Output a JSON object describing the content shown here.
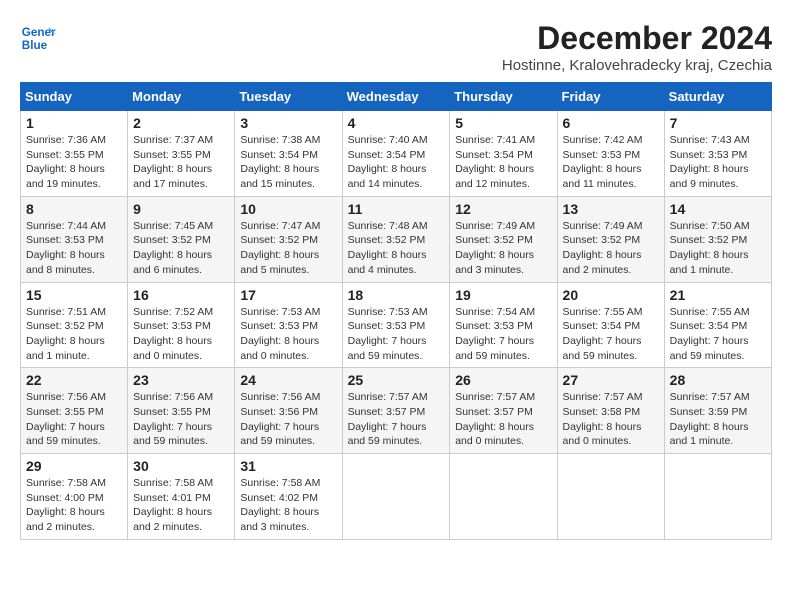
{
  "logo": {
    "line1": "General",
    "line2": "Blue"
  },
  "title": "December 2024",
  "subtitle": "Hostinne, Kralovehradecky kraj, Czechia",
  "headers": [
    "Sunday",
    "Monday",
    "Tuesday",
    "Wednesday",
    "Thursday",
    "Friday",
    "Saturday"
  ],
  "weeks": [
    [
      {
        "day": "1",
        "sunrise": "7:36 AM",
        "sunset": "3:55 PM",
        "daylight": "8 hours and 19 minutes."
      },
      {
        "day": "2",
        "sunrise": "7:37 AM",
        "sunset": "3:55 PM",
        "daylight": "8 hours and 17 minutes."
      },
      {
        "day": "3",
        "sunrise": "7:38 AM",
        "sunset": "3:54 PM",
        "daylight": "8 hours and 15 minutes."
      },
      {
        "day": "4",
        "sunrise": "7:40 AM",
        "sunset": "3:54 PM",
        "daylight": "8 hours and 14 minutes."
      },
      {
        "day": "5",
        "sunrise": "7:41 AM",
        "sunset": "3:54 PM",
        "daylight": "8 hours and 12 minutes."
      },
      {
        "day": "6",
        "sunrise": "7:42 AM",
        "sunset": "3:53 PM",
        "daylight": "8 hours and 11 minutes."
      },
      {
        "day": "7",
        "sunrise": "7:43 AM",
        "sunset": "3:53 PM",
        "daylight": "8 hours and 9 minutes."
      }
    ],
    [
      {
        "day": "8",
        "sunrise": "7:44 AM",
        "sunset": "3:53 PM",
        "daylight": "8 hours and 8 minutes."
      },
      {
        "day": "9",
        "sunrise": "7:45 AM",
        "sunset": "3:52 PM",
        "daylight": "8 hours and 6 minutes."
      },
      {
        "day": "10",
        "sunrise": "7:47 AM",
        "sunset": "3:52 PM",
        "daylight": "8 hours and 5 minutes."
      },
      {
        "day": "11",
        "sunrise": "7:48 AM",
        "sunset": "3:52 PM",
        "daylight": "8 hours and 4 minutes."
      },
      {
        "day": "12",
        "sunrise": "7:49 AM",
        "sunset": "3:52 PM",
        "daylight": "8 hours and 3 minutes."
      },
      {
        "day": "13",
        "sunrise": "7:49 AM",
        "sunset": "3:52 PM",
        "daylight": "8 hours and 2 minutes."
      },
      {
        "day": "14",
        "sunrise": "7:50 AM",
        "sunset": "3:52 PM",
        "daylight": "8 hours and 1 minute."
      }
    ],
    [
      {
        "day": "15",
        "sunrise": "7:51 AM",
        "sunset": "3:52 PM",
        "daylight": "8 hours and 1 minute."
      },
      {
        "day": "16",
        "sunrise": "7:52 AM",
        "sunset": "3:53 PM",
        "daylight": "8 hours and 0 minutes."
      },
      {
        "day": "17",
        "sunrise": "7:53 AM",
        "sunset": "3:53 PM",
        "daylight": "8 hours and 0 minutes."
      },
      {
        "day": "18",
        "sunrise": "7:53 AM",
        "sunset": "3:53 PM",
        "daylight": "7 hours and 59 minutes."
      },
      {
        "day": "19",
        "sunrise": "7:54 AM",
        "sunset": "3:53 PM",
        "daylight": "7 hours and 59 minutes."
      },
      {
        "day": "20",
        "sunrise": "7:55 AM",
        "sunset": "3:54 PM",
        "daylight": "7 hours and 59 minutes."
      },
      {
        "day": "21",
        "sunrise": "7:55 AM",
        "sunset": "3:54 PM",
        "daylight": "7 hours and 59 minutes."
      }
    ],
    [
      {
        "day": "22",
        "sunrise": "7:56 AM",
        "sunset": "3:55 PM",
        "daylight": "7 hours and 59 minutes."
      },
      {
        "day": "23",
        "sunrise": "7:56 AM",
        "sunset": "3:55 PM",
        "daylight": "7 hours and 59 minutes."
      },
      {
        "day": "24",
        "sunrise": "7:56 AM",
        "sunset": "3:56 PM",
        "daylight": "7 hours and 59 minutes."
      },
      {
        "day": "25",
        "sunrise": "7:57 AM",
        "sunset": "3:57 PM",
        "daylight": "7 hours and 59 minutes."
      },
      {
        "day": "26",
        "sunrise": "7:57 AM",
        "sunset": "3:57 PM",
        "daylight": "8 hours and 0 minutes."
      },
      {
        "day": "27",
        "sunrise": "7:57 AM",
        "sunset": "3:58 PM",
        "daylight": "8 hours and 0 minutes."
      },
      {
        "day": "28",
        "sunrise": "7:57 AM",
        "sunset": "3:59 PM",
        "daylight": "8 hours and 1 minute."
      }
    ],
    [
      {
        "day": "29",
        "sunrise": "7:58 AM",
        "sunset": "4:00 PM",
        "daylight": "8 hours and 2 minutes."
      },
      {
        "day": "30",
        "sunrise": "7:58 AM",
        "sunset": "4:01 PM",
        "daylight": "8 hours and 2 minutes."
      },
      {
        "day": "31",
        "sunrise": "7:58 AM",
        "sunset": "4:02 PM",
        "daylight": "8 hours and 3 minutes."
      },
      null,
      null,
      null,
      null
    ]
  ]
}
